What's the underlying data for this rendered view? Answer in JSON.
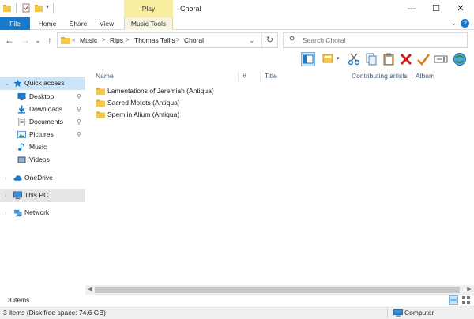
{
  "window": {
    "title": "Choral",
    "contextual_tab": "Play",
    "minimize": "—",
    "maximize": "☐",
    "close": "✕"
  },
  "ribbon": {
    "tabs": [
      "File",
      "Home",
      "Share",
      "View",
      "Music Tools"
    ],
    "chevron": "⌄",
    "help": "?"
  },
  "address": {
    "prefix": "«",
    "crumbs": [
      "Music",
      "Rips",
      "Thomas Tallis",
      "Choral"
    ],
    "separator": ">",
    "dropdown": "⌄",
    "refresh": "↻"
  },
  "search": {
    "placeholder": "Search Choral",
    "icon": "⚲"
  },
  "nav_buttons": {
    "back": "←",
    "forward": "→",
    "recent": "⌄",
    "up": "↑"
  },
  "sidebar": {
    "items": [
      {
        "label": "Quick access",
        "icon": "star-icon",
        "pinned": false
      },
      {
        "label": "Desktop",
        "icon": "desktop-icon",
        "pinned": true
      },
      {
        "label": "Downloads",
        "icon": "download-icon",
        "pinned": true
      },
      {
        "label": "Documents",
        "icon": "documents-icon",
        "pinned": true
      },
      {
        "label": "Pictures",
        "icon": "pictures-icon",
        "pinned": true
      },
      {
        "label": "Music",
        "icon": "music-icon",
        "pinned": false
      },
      {
        "label": "Videos",
        "icon": "videos-icon",
        "pinned": false
      },
      {
        "label": "OneDrive",
        "icon": "cloud-icon",
        "pinned": false
      },
      {
        "label": "This PC",
        "icon": "computer-icon",
        "pinned": false
      },
      {
        "label": "Network",
        "icon": "network-icon",
        "pinned": false
      }
    ],
    "pin_glyph": "📌"
  },
  "columns": [
    "Name",
    "#",
    "Title",
    "Contributing artists",
    "Album"
  ],
  "files": [
    {
      "name": "Lamentations of Jeremiah (Antiqua)"
    },
    {
      "name": "Sacred Motets (Antiqua)"
    },
    {
      "name": "Spem in Alium (Antiqua)"
    }
  ],
  "status": {
    "item_count": "3 items"
  },
  "infobar": {
    "text": "3 items (Disk free space: 74.6 GB)",
    "location": "Computer"
  },
  "colors": {
    "accent": "#1979ca",
    "play_tab": "#f8eea0",
    "selection": "#cce4f7",
    "folder": "#f5c84c"
  }
}
